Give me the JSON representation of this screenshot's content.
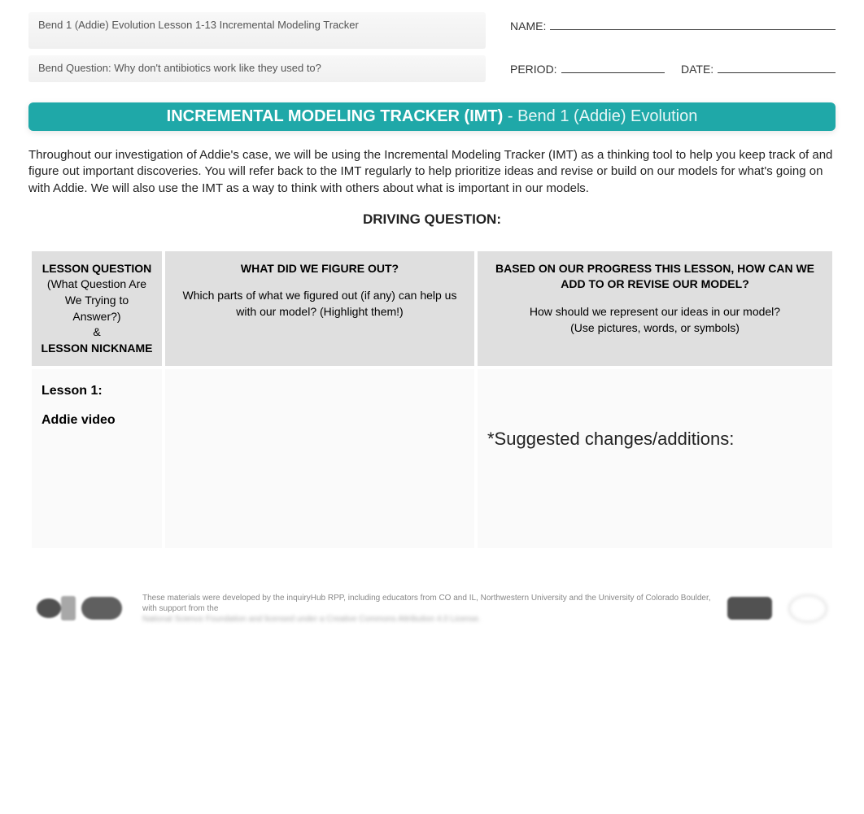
{
  "header": {
    "title_line1": "Bend 1 (Addie) Evolution Lesson 1-13 Incremental Modeling Tracker",
    "title_line2": "Bend Question: Why don't antibiotics work like they used to?",
    "name_label": "NAME:",
    "period_label": "PERIOD:",
    "date_label": "DATE:"
  },
  "banner": {
    "bold": "INCREMENTAL MODELING TRACKER (IMT)",
    "rest": " - Bend 1 (Addie) Evolution"
  },
  "intro": "Throughout our investigation of Addie's case, we will be using the Incremental Modeling Tracker (IMT) as a thinking tool to help you keep track of and figure out important discoveries. You will refer back to the IMT regularly to help prioritize ideas and revise or build on our models for what's going on with Addie. We will also use the IMT as a way to think with others about what is important in our models.",
  "driving_question_label": "DRIVING QUESTION:",
  "table": {
    "headers": {
      "col1_bold1": "LESSON QUESTION",
      "col1_sub": "(What Question Are We Trying to Answer?)",
      "col1_amp": "&",
      "col1_bold2": "LESSON NICKNAME",
      "col2_bold": "WHAT DID WE FIGURE OUT?",
      "col2_sub": "Which parts of what we figured out (if any) can help us with our model? (Highlight them!)",
      "col3_bold": "BASED ON OUR PROGRESS THIS LESSON, HOW CAN WE ADD TO OR REVISE OUR MODEL?",
      "col3_sub1": "How should we represent our ideas in our model?",
      "col3_sub2": "(Use pictures, words, or symbols)"
    },
    "rows": [
      {
        "lesson_label": "Lesson 1:",
        "lesson_nickname": "Addie video",
        "figured_out": "",
        "revise": "*Suggested changes/additions:"
      }
    ]
  },
  "footer": {
    "line1": "These materials were developed by the inquiryHub RPP, including educators from CO and IL, Northwestern University and the University of Colorado Boulder, with support from the",
    "line2": "National Science Foundation and licensed under a Creative Commons Attribution 4.0 License."
  }
}
